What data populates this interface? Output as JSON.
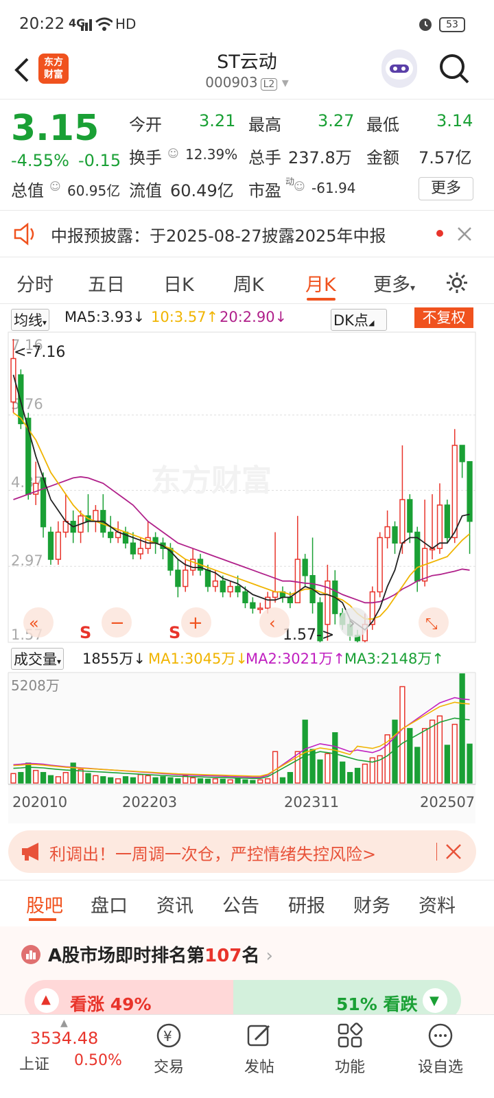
{
  "status": {
    "time": "20:22",
    "network": "4G",
    "hd": "HD",
    "battery": "53"
  },
  "header": {
    "logo_text_1": "东方",
    "logo_text_2": "财富",
    "title": "ST云动",
    "code": "000903",
    "level": "L2"
  },
  "quote": {
    "price": "3.15",
    "pct": "-4.55%",
    "change": "-0.15",
    "open_label": "今开",
    "open": "3.21",
    "high_label": "最高",
    "high": "3.27",
    "low_label": "最低",
    "low": "3.14",
    "turnover_label": "换手",
    "turnover": "12.39%",
    "vol_label": "总手",
    "vol": "237.8万",
    "amount_label": "金额",
    "amount": "7.57亿",
    "mcap_label": "总值",
    "mcap": "60.95亿",
    "float_label": "流值",
    "float": "60.49亿",
    "pe_label": "市盈",
    "pe_sup": "动",
    "pe": "-61.94",
    "more": "更多"
  },
  "notice": {
    "text": "中报预披露：于2025-08-27披露2025年中报"
  },
  "period_tabs": [
    "分时",
    "五日",
    "日K",
    "周K",
    "月K",
    "更多"
  ],
  "active_tab": "月K",
  "ma": {
    "select": "均线",
    "ma5": "MA5:3.93↓",
    "ma10": "10:3.57↑",
    "ma20": "20:2.90↓",
    "dk": "DK点",
    "fq": "不复权"
  },
  "chart_labels": {
    "y1": "7.16",
    "y2": "5.76",
    "y3": "4.37",
    "y4": "2.97",
    "y5": "1.57",
    "max_note": "<-7.16",
    "min_note": "1.57->",
    "watermark": "东方财富",
    "s1": "S",
    "s2": "S"
  },
  "vol": {
    "select": "成交量",
    "value": "1855万↓",
    "ma1": "MA1:3045万↓",
    "ma2": "MA2:3021万↑",
    "ma3": "MA3:2148万↑",
    "ymax": "5208万"
  },
  "x_labels": [
    "202010",
    "202203",
    "202311",
    "202507"
  ],
  "colors": {
    "up": "#e8342b",
    "down": "#1aa035",
    "ma5": "#222222",
    "ma10": "#f0b400",
    "ma20": "#b0208a",
    "accent": "#f0521e"
  },
  "chart_data": {
    "type": "candlestick",
    "price_ylim": [
      1.57,
      7.16
    ],
    "vol_ymax_wan": 5208,
    "candles": [
      [
        6.0,
        6.8,
        7.16,
        5.8
      ],
      [
        6.5,
        5.6,
        6.6,
        5.5
      ],
      [
        5.7,
        4.3,
        5.8,
        4.2
      ],
      [
        4.3,
        4.5,
        4.9,
        4.1
      ],
      [
        4.6,
        3.7,
        4.7,
        3.5
      ],
      [
        3.6,
        3.1,
        3.7,
        3.0
      ],
      [
        3.1,
        3.6,
        3.8,
        3.0
      ],
      [
        3.6,
        3.8,
        4.3,
        3.5
      ],
      [
        3.8,
        3.6,
        4.0,
        3.4
      ],
      [
        3.6,
        3.9,
        4.0,
        3.4
      ],
      [
        3.9,
        3.8,
        4.3,
        3.6
      ],
      [
        3.8,
        4.0,
        4.1,
        3.6
      ],
      [
        4.0,
        3.6,
        4.3,
        3.5
      ],
      [
        3.6,
        3.5,
        3.9,
        3.4
      ],
      [
        3.5,
        3.6,
        3.8,
        3.4
      ],
      [
        3.6,
        3.4,
        3.7,
        3.3
      ],
      [
        3.4,
        3.2,
        3.6,
        3.1
      ],
      [
        3.2,
        3.3,
        3.5,
        3.1
      ],
      [
        3.3,
        3.5,
        3.8,
        3.2
      ],
      [
        3.5,
        3.4,
        3.6,
        3.2
      ],
      [
        3.4,
        3.3,
        3.5,
        3.1
      ],
      [
        3.3,
        2.9,
        3.4,
        2.8
      ],
      [
        2.9,
        2.6,
        3.1,
        2.4
      ],
      [
        2.6,
        2.9,
        3.1,
        2.5
      ],
      [
        2.9,
        3.1,
        3.3,
        2.8
      ],
      [
        3.1,
        2.9,
        3.2,
        2.8
      ],
      [
        2.9,
        2.6,
        3.0,
        2.5
      ],
      [
        2.6,
        2.7,
        2.9,
        2.5
      ],
      [
        2.7,
        2.5,
        2.8,
        2.4
      ],
      [
        2.5,
        2.6,
        2.7,
        2.4
      ],
      [
        2.6,
        2.5,
        2.8,
        2.4
      ],
      [
        2.5,
        2.3,
        2.6,
        2.2
      ],
      [
        2.3,
        2.2,
        2.4,
        2.1
      ],
      [
        2.2,
        2.2,
        2.3,
        2.1
      ],
      [
        2.2,
        2.4,
        2.5,
        2.1
      ],
      [
        2.4,
        2.5,
        3.6,
        2.3
      ],
      [
        2.5,
        2.4,
        2.6,
        2.3
      ],
      [
        2.4,
        2.3,
        2.5,
        2.2
      ],
      [
        2.3,
        3.1,
        3.9,
        2.3
      ],
      [
        3.1,
        2.8,
        3.2,
        2.6
      ],
      [
        2.8,
        2.3,
        3.5,
        2.1
      ],
      [
        2.3,
        1.6,
        2.4,
        1.57
      ],
      [
        1.9,
        2.7,
        3.0,
        1.6
      ],
      [
        2.7,
        2.1,
        2.9,
        1.9
      ],
      [
        2.1,
        1.9,
        2.2,
        1.8
      ],
      [
        1.9,
        1.7,
        2.0,
        1.6
      ],
      [
        1.7,
        1.6,
        1.8,
        1.57
      ],
      [
        1.6,
        1.9,
        2.1,
        1.57
      ],
      [
        1.9,
        2.5,
        2.6,
        1.8
      ],
      [
        2.5,
        3.5,
        3.6,
        2.4
      ],
      [
        3.5,
        3.7,
        4.0,
        3.3
      ],
      [
        3.7,
        3.4,
        3.8,
        3.2
      ],
      [
        3.4,
        4.2,
        5.2,
        3.2
      ],
      [
        4.2,
        3.6,
        4.3,
        3.4
      ],
      [
        3.6,
        2.7,
        3.7,
        2.5
      ],
      [
        2.7,
        3.3,
        4.2,
        2.6
      ],
      [
        3.3,
        3.3,
        4.3,
        3.1
      ],
      [
        3.3,
        4.1,
        4.5,
        3.2
      ],
      [
        4.1,
        3.5,
        4.2,
        3.4
      ],
      [
        3.5,
        5.2,
        5.5,
        3.4
      ],
      [
        5.2,
        4.9,
        5.2,
        4.6
      ],
      [
        4.9,
        3.8,
        4.9,
        3.2
      ]
    ],
    "candle_format": "[open, close, high, low]",
    "ma5": [
      6.5,
      6.0,
      5.5,
      5.0,
      4.6,
      4.2,
      4.0,
      3.8,
      3.7,
      3.75,
      3.8,
      3.8,
      3.8,
      3.7,
      3.6,
      3.55,
      3.5,
      3.45,
      3.4,
      3.4,
      3.35,
      3.25,
      3.1,
      3.0,
      2.95,
      2.95,
      2.9,
      2.85,
      2.75,
      2.7,
      2.65,
      2.55,
      2.45,
      2.4,
      2.35,
      2.35,
      2.4,
      2.4,
      2.5,
      2.6,
      2.55,
      2.45,
      2.45,
      2.4,
      2.3,
      2.0,
      1.9,
      1.8,
      1.95,
      2.2,
      2.6,
      2.9,
      3.4,
      3.5,
      3.5,
      3.4,
      3.3,
      3.4,
      3.4,
      3.6,
      3.9,
      3.93
    ],
    "ma10": [
      5.8,
      5.7,
      5.5,
      5.3,
      5.0,
      4.7,
      4.5,
      4.3,
      4.1,
      3.95,
      3.85,
      3.8,
      3.75,
      3.7,
      3.65,
      3.6,
      3.55,
      3.5,
      3.45,
      3.4,
      3.35,
      3.3,
      3.2,
      3.1,
      3.05,
      3.0,
      2.95,
      2.9,
      2.85,
      2.8,
      2.75,
      2.7,
      2.65,
      2.6,
      2.55,
      2.5,
      2.5,
      2.45,
      2.5,
      2.55,
      2.55,
      2.5,
      2.45,
      2.4,
      2.35,
      2.25,
      2.1,
      2.0,
      2.0,
      2.05,
      2.2,
      2.4,
      2.6,
      2.8,
      2.95,
      3.0,
      3.05,
      3.1,
      3.15,
      3.3,
      3.45,
      3.57
    ],
    "ma20": [
      4.2,
      4.25,
      4.3,
      4.35,
      4.4,
      4.45,
      4.5,
      4.55,
      4.6,
      4.62,
      4.6,
      4.55,
      4.5,
      4.4,
      4.3,
      4.2,
      4.1,
      3.95,
      3.8,
      3.7,
      3.6,
      3.5,
      3.4,
      3.35,
      3.3,
      3.25,
      3.2,
      3.15,
      3.1,
      3.05,
      3.0,
      2.95,
      2.9,
      2.85,
      2.8,
      2.75,
      2.7,
      2.7,
      2.68,
      2.66,
      2.65,
      2.62,
      2.58,
      2.52,
      2.45,
      2.4,
      2.35,
      2.3,
      2.3,
      2.32,
      2.38,
      2.45,
      2.55,
      2.62,
      2.7,
      2.75,
      2.8,
      2.82,
      2.85,
      2.88,
      2.92,
      2.9
    ],
    "volume_wan": [
      450,
      500,
      950,
      600,
      500,
      350,
      300,
      500,
      950,
      650,
      450,
      350,
      300,
      250,
      200,
      300,
      250,
      400,
      350,
      250,
      300,
      250,
      200,
      350,
      250,
      200,
      180,
      200,
      180,
      150,
      200,
      150,
      120,
      150,
      200,
      1500,
      250,
      500,
      1500,
      3000,
      1600,
      1100,
      1400,
      2400,
      1000,
      500,
      700,
      900,
      1200,
      1300,
      2300,
      3000,
      4600,
      2600,
      1700,
      2600,
      3000,
      3200,
      1800,
      2800,
      5208,
      1855
    ],
    "vol_ma": [
      700,
      720,
      750,
      740,
      720,
      680,
      650,
      620,
      600,
      580,
      560,
      540,
      520,
      500,
      480,
      460,
      440,
      420,
      400,
      380,
      360,
      340,
      320,
      310,
      300,
      290,
      280,
      270,
      260,
      250,
      240,
      230,
      220,
      220,
      300,
      500,
      700,
      900,
      1100,
      1300,
      1400,
      1500,
      1450,
      1400,
      1300,
      1200,
      1100,
      1050,
      1000,
      1100,
      1300,
      1600,
      1900,
      2100,
      2300,
      2500,
      2700,
      2900,
      3000,
      3100,
      3045,
      3021
    ]
  },
  "ad": {
    "text": "利调出！一周调一次仓，严控情绪失控风险>"
  },
  "bottom_tabs": [
    "股吧",
    "盘口",
    "资讯",
    "公告",
    "研报",
    "财务",
    "资料"
  ],
  "rank": {
    "prefix": "A股市场即时排名第",
    "num": "107",
    "suffix": "名"
  },
  "sentiment": {
    "bull": "看涨 49%",
    "bear": "51% 看跌"
  },
  "index": {
    "value": "3534.48",
    "name": "上证",
    "pct": "0.50%"
  },
  "nav": [
    "交易",
    "发帖",
    "功能",
    "设自选"
  ]
}
